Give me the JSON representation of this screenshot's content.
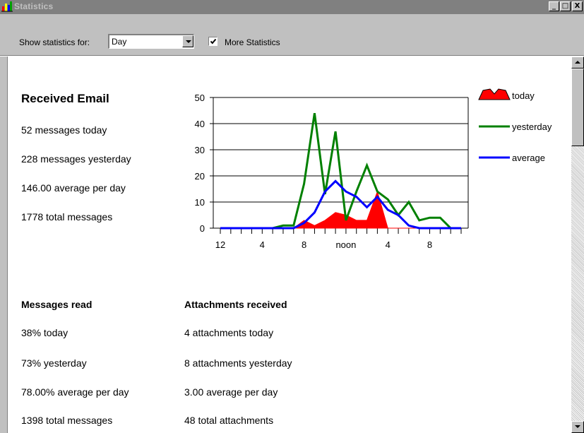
{
  "window": {
    "title": "Statistics",
    "buttons": {
      "minimize": "_",
      "maximize": "□",
      "close": "X"
    }
  },
  "toolbar": {
    "show_label": "Show statistics for:",
    "period_value": "Day",
    "more_stats_label": "More Statistics",
    "more_stats_checked": true
  },
  "received": {
    "heading": "Received Email",
    "today": "52 messages today",
    "yesterday": "228 messages yesterday",
    "average": "146.00 average per day",
    "total": "1778 total messages"
  },
  "read": {
    "heading": "Messages read",
    "today": "38% today",
    "yesterday": "73% yesterday",
    "average": "78.00% average per day",
    "total": "1398 total messages"
  },
  "attachments": {
    "heading": "Attachments received",
    "today": "4 attachments today",
    "yesterday": "8 attachments yesterday",
    "average": "3.00 average per day",
    "total": "48 total attachments"
  },
  "chart_data": {
    "type": "area",
    "x": [
      0,
      1,
      2,
      3,
      4,
      5,
      6,
      7,
      8,
      9,
      10,
      11,
      12,
      13,
      14,
      15,
      16,
      17,
      18,
      19,
      20,
      21,
      22,
      23
    ],
    "x_tick_labels": {
      "0": "12",
      "4": "4",
      "8": "8",
      "12": "noon",
      "16": "4",
      "20": "8"
    },
    "ylim": [
      0,
      50
    ],
    "y_ticks": [
      0,
      10,
      20,
      30,
      40,
      50
    ],
    "grid": true,
    "legend_position": "right",
    "series": [
      {
        "name": "today",
        "kind": "area",
        "color": "#ff0000",
        "values": [
          0,
          0,
          0,
          0,
          0,
          0,
          0,
          0,
          3,
          1,
          3,
          6,
          5,
          3,
          3,
          14,
          0,
          0,
          0,
          0,
          0,
          0,
          0,
          0
        ]
      },
      {
        "name": "yesterday",
        "kind": "line",
        "color": "#008000",
        "values": [
          0,
          0,
          0,
          0,
          0,
          0,
          1,
          1,
          17,
          44,
          13,
          37,
          3,
          14,
          24,
          14,
          11,
          5,
          10,
          3,
          4,
          4,
          0,
          0
        ]
      },
      {
        "name": "average",
        "kind": "line",
        "color": "#0000ff",
        "values": [
          0,
          0,
          0,
          0,
          0,
          0,
          0,
          0,
          2,
          6,
          14,
          18,
          14,
          12,
          8,
          12,
          7,
          5,
          1,
          0,
          0,
          0,
          0,
          0
        ]
      }
    ]
  }
}
